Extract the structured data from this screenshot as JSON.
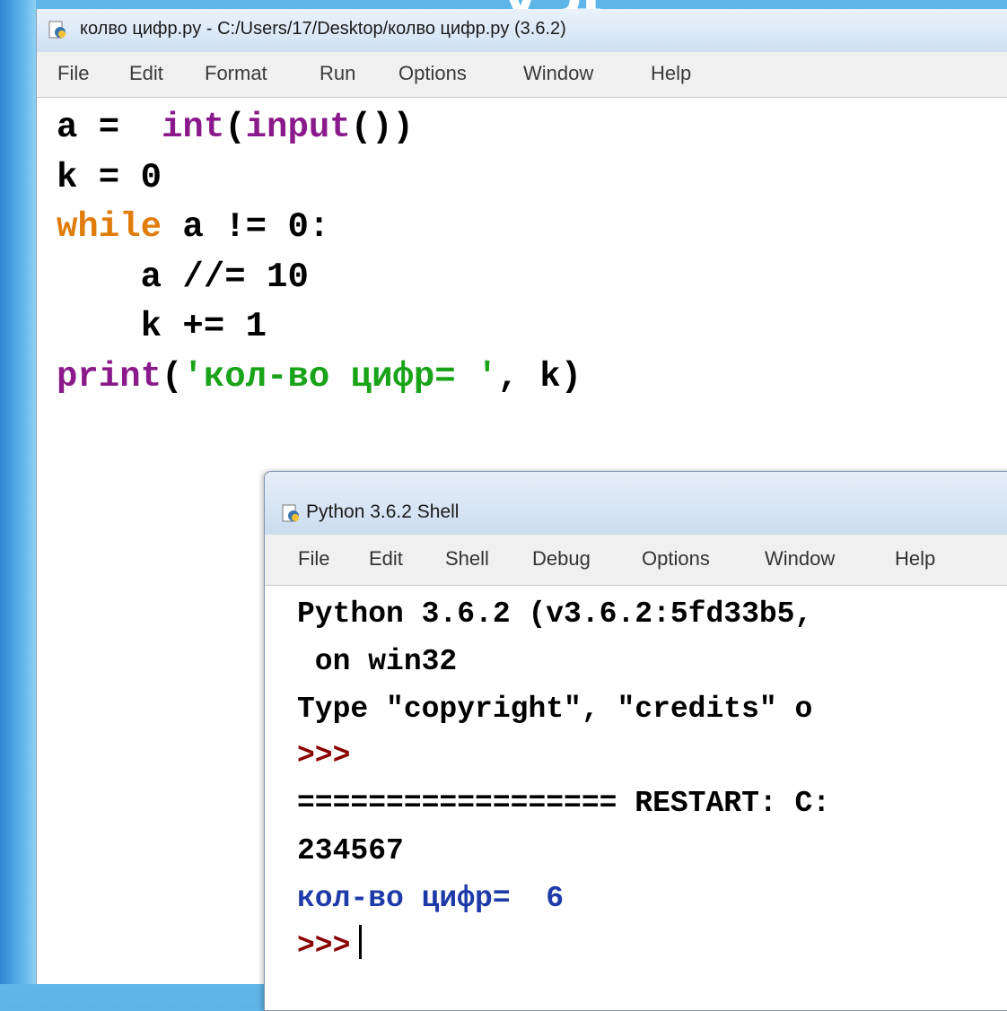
{
  "slide": {
    "title_fragment": "у д"
  },
  "editor": {
    "title": "колво цифр.py - C:/Users/17/Desktop/колво цифр.py (3.6.2)",
    "menu": [
      "File",
      "Edit",
      "Format",
      "Run",
      "Options",
      "Window",
      "Help"
    ],
    "code": {
      "l1_a": "a =  ",
      "l1_int": "int",
      "l1_p1": "(",
      "l1_input": "input",
      "l1_rest": "())",
      "l2": "k = 0",
      "l3_kw": "while",
      "l3_rest": " a != 0:",
      "l4": "    a //= 10",
      "l5": "    k += 1",
      "l6_print": "print",
      "l6_p1": "(",
      "l6_str": "'кол-во цифр= '",
      "l6_rest": ", k)"
    }
  },
  "shell": {
    "title": "Python 3.6.2 Shell",
    "menu": [
      "File",
      "Edit",
      "Shell",
      "Debug",
      "Options",
      "Window",
      "Help"
    ],
    "lines": {
      "banner1": "Python 3.6.2 (v3.6.2:5fd33b5,",
      "banner2": " on win32",
      "banner3": "Type \"copyright\", \"credits\" o",
      "prompt1": ">>>",
      "restart": "================== RESTART: C:",
      "input_value": "234567",
      "output": "кол-во цифр=  6",
      "prompt2": ">>>"
    }
  }
}
